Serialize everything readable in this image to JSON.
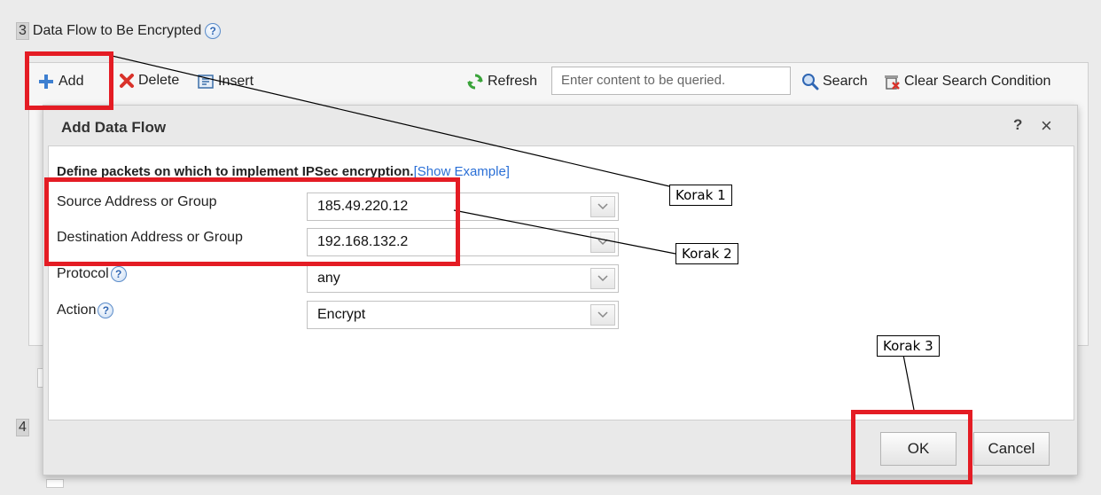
{
  "section": {
    "number": "3",
    "title": "Data Flow to Be Encrypted",
    "next_number": "4"
  },
  "toolbar": {
    "add_label": "Add",
    "delete_label": "Delete",
    "insert_label": "Insert",
    "refresh_label": "Refresh",
    "search_placeholder": "Enter content to be queried.",
    "search_label": "Search",
    "clear_label": "Clear Search Condition"
  },
  "dialog": {
    "title": "Add Data Flow",
    "help_label": "?",
    "close_label": "×",
    "intro": "Define packets on which to implement IPSec encryption.",
    "example_link": "[Show Example]",
    "fields": [
      {
        "label": "Source Address or Group",
        "value": "185.49.220.12",
        "help": false
      },
      {
        "label": "Destination Address or Group",
        "value": "192.168.132.2",
        "help": false
      },
      {
        "label": "Protocol",
        "value": "any",
        "help": true
      },
      {
        "label": "Action",
        "value": "Encrypt",
        "help": true
      }
    ],
    "ok_label": "OK",
    "cancel_label": "Cancel"
  },
  "annotations": {
    "step1": "Korak 1",
    "step2": "Korak 2",
    "step3": "Korak 3",
    "highlight_color": "#e41c24"
  }
}
